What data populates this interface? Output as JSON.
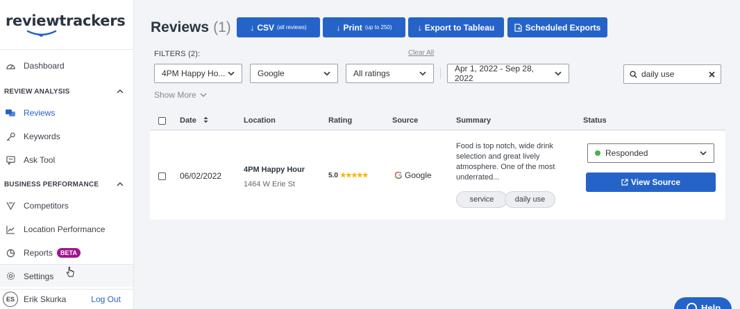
{
  "app": {
    "logo": "reviewtrackers",
    "brand_color": "#2563c9"
  },
  "sidebar": {
    "dashboard": "Dashboard",
    "review_analysis": {
      "heading": "REVIEW ANALYSIS",
      "items": [
        {
          "label": "Reviews",
          "icon": "reviews-icon",
          "active": true
        },
        {
          "label": "Keywords",
          "icon": "key-icon"
        },
        {
          "label": "Ask Tool",
          "icon": "chat-icon"
        }
      ]
    },
    "business_performance": {
      "heading": "BUSINESS PERFORMANCE",
      "items": [
        {
          "label": "Competitors",
          "icon": "competitors-icon"
        },
        {
          "label": "Location Performance",
          "icon": "chart-line-icon"
        },
        {
          "label": "Reports",
          "icon": "pie-chart-icon",
          "badge": "BETA"
        }
      ]
    },
    "settings": "Settings",
    "user": {
      "initials": "ES",
      "name": "Erik Skurka",
      "logout": "Log Out"
    }
  },
  "header": {
    "title": "Reviews",
    "count": "(1)",
    "buttons": {
      "csv": "CSV",
      "csv_note": "(all reviews)",
      "print": "Print",
      "print_note": "(up to 250)",
      "tableau": "Export to Tableau",
      "scheduled": "Scheduled Exports"
    }
  },
  "filters": {
    "label": "FILTERS (2):",
    "clear_all": "Clear All",
    "location": "4PM Happy Ho...",
    "source": "Google",
    "rating": "All ratings",
    "date_range": "Apr 1, 2022 - Sep 28, 2022",
    "search_value": "daily use",
    "show_more": "Show More"
  },
  "table": {
    "columns": [
      "Date",
      "Location",
      "Rating",
      "Source",
      "Summary",
      "Status"
    ],
    "rows": [
      {
        "date": "06/02/2022",
        "location_name": "4PM Happy Hour",
        "location_address": "1464 W Erie St",
        "rating": "5.0",
        "stars": "★★★★★",
        "source": "Google",
        "summary": "Food is top notch, wide drink selection and great lively atmosphere. One of the most underrated...",
        "tags": [
          "service",
          "daily use"
        ],
        "status": "Responded",
        "view_source": "View Source"
      }
    ]
  },
  "help": "Help"
}
